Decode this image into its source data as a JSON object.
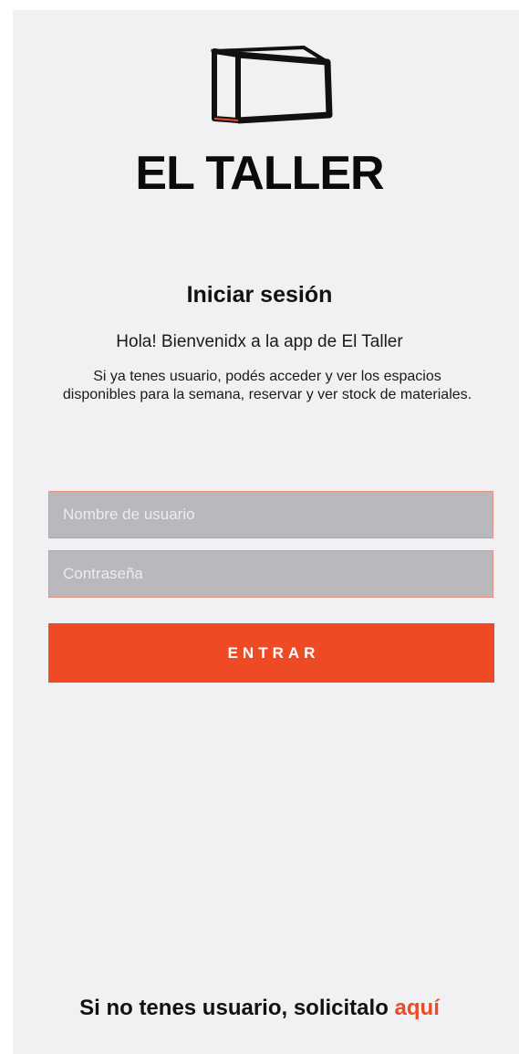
{
  "brand": {
    "logo_icon": "box-frame-logo",
    "name": "EL TALLER"
  },
  "login": {
    "title": "Iniciar sesión",
    "greeting": "Hola! Bienvenidx a la app de El Taller",
    "description": "Si ya tenes usuario, podés acceder y ver los espacios disponibles para la semana, reservar y ver stock de materiales.",
    "username_placeholder": "Nombre de usuario",
    "username_value": "",
    "password_placeholder": "Contraseña",
    "password_value": "",
    "submit_label": "ENTRAR"
  },
  "footer": {
    "prompt": "Si no tenes usuario, solicitalo ",
    "link_label": "aquí"
  },
  "colors": {
    "accent": "#ed4a25",
    "background": "#f1f1f3",
    "input_bg": "#b9b9bd",
    "text": "#111111"
  }
}
